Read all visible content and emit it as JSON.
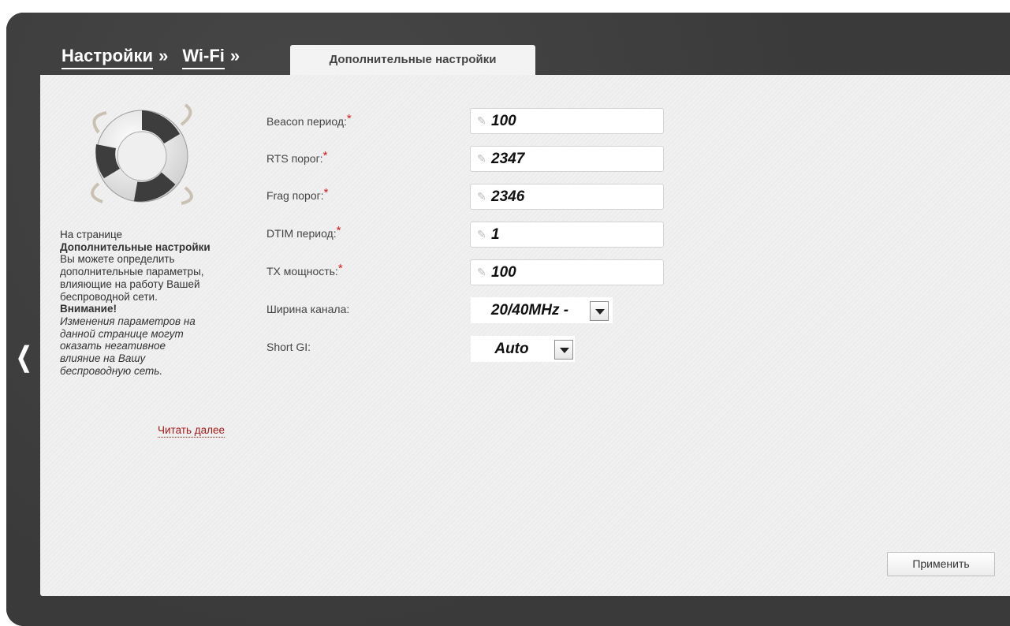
{
  "breadcrumb": {
    "level1": "Настройки",
    "level2": "Wi-Fi",
    "separator": "»"
  },
  "tab": {
    "label": "Дополнительные настройки"
  },
  "help": {
    "line1": "На странице",
    "line2": "Дополнительные настройки",
    "line3": "Вы можете определить",
    "line4": "дополнительные параметры,",
    "line5": "влияющие на работу Вашей",
    "line6": "беспроводной сети.",
    "warning_title": "Внимание!",
    "warn1": "Изменения параметров на",
    "warn2": "данной странице могут",
    "warn3": "оказать негативное",
    "warn4": "влияние на Вашу",
    "warn5": "беспроводную сеть.",
    "read_more": "Читать далее"
  },
  "form": {
    "required_mark": "*",
    "beacon_label": "Beacon период:",
    "beacon_value": "100",
    "rts_label": "RTS порог:",
    "rts_value": "2347",
    "frag_label": "Frag порог:",
    "frag_value": "2346",
    "dtim_label": "DTIM период:",
    "dtim_value": "1",
    "tx_label": "TX мощность:",
    "tx_value": "100",
    "width_label": "Ширина канала:",
    "width_value": "20/40MHz -",
    "shortgi_label": "Short GI:",
    "shortgi_value": "Auto"
  },
  "apply_label": "Применить",
  "icons": {
    "nav_back": "chevron-left-icon",
    "help": "lifebuoy-icon",
    "edit": "pencil-icon",
    "dropdown": "caret-down-icon"
  },
  "colors": {
    "frame": "#3a3a3a",
    "panel": "#efefef",
    "required": "#e01818",
    "link": "#a31b1b"
  }
}
